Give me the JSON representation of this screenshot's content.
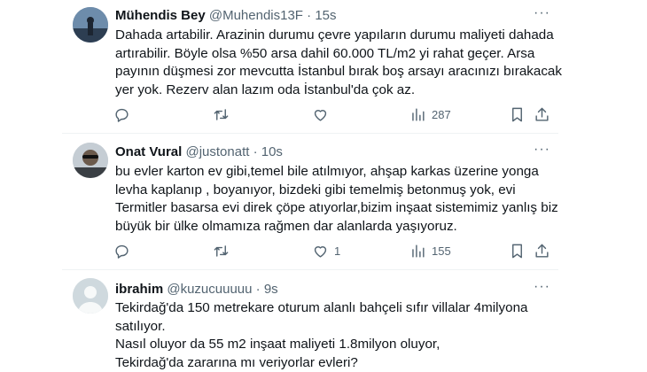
{
  "tweets": [
    {
      "name": "Mühendis Bey",
      "handle": "@Muhendis13F",
      "time": "· 15s",
      "lines": [
        "Dahada artabilir. Arazinin durumu çevre yapıların durumu maliyeti dahada",
        "artırabilir. Böyle olsa %50 arsa dahil 60.000 TL/m2 yi rahat geçer. Arsa",
        "payının düşmesi zor mevcutta İstanbul bırak boş arsayı aracınızı bırakacak",
        "yer yok. Rezerv alan lazım oda İstanbul'da çok az."
      ],
      "replies": "",
      "retweets": "",
      "likes": "",
      "views": "287"
    },
    {
      "name": "Onat Vural",
      "handle": "@justonatt",
      "time": "· 10s",
      "lines": [
        "bu evler karton ev gibi,temel bile atılmıyor, ahşap karkas üzerine yonga",
        "levha kaplanıp , boyanıyor, bizdeki gibi temelmiş betonmuş yok, evi",
        "Termitler basarsa evi direk çöpe atıyorlar,bizim inşaat sistemimiz yanlış biz",
        "büyük bir ülke olmamıza rağmen dar alanlarda yaşıyoruz."
      ],
      "replies": "",
      "retweets": "",
      "likes": "1",
      "views": "155"
    },
    {
      "name": "ibrahim",
      "handle": "@kuzucuuuuu",
      "time": "· 9s",
      "lines": [
        "Tekirdağ'da 150 metrekare oturum alanlı bahçeli  sıfır villalar 4milyona",
        "satılıyor.",
        "Nasıl oluyor da 55 m2 inşaat maliyeti 1.8milyon oluyor,",
        "Tekirdağ'da zararına mı veriyorlar evleri?"
      ]
    }
  ],
  "colors": {
    "text": "#0f1419",
    "secondary": "#536471",
    "border": "#eff3f4"
  }
}
